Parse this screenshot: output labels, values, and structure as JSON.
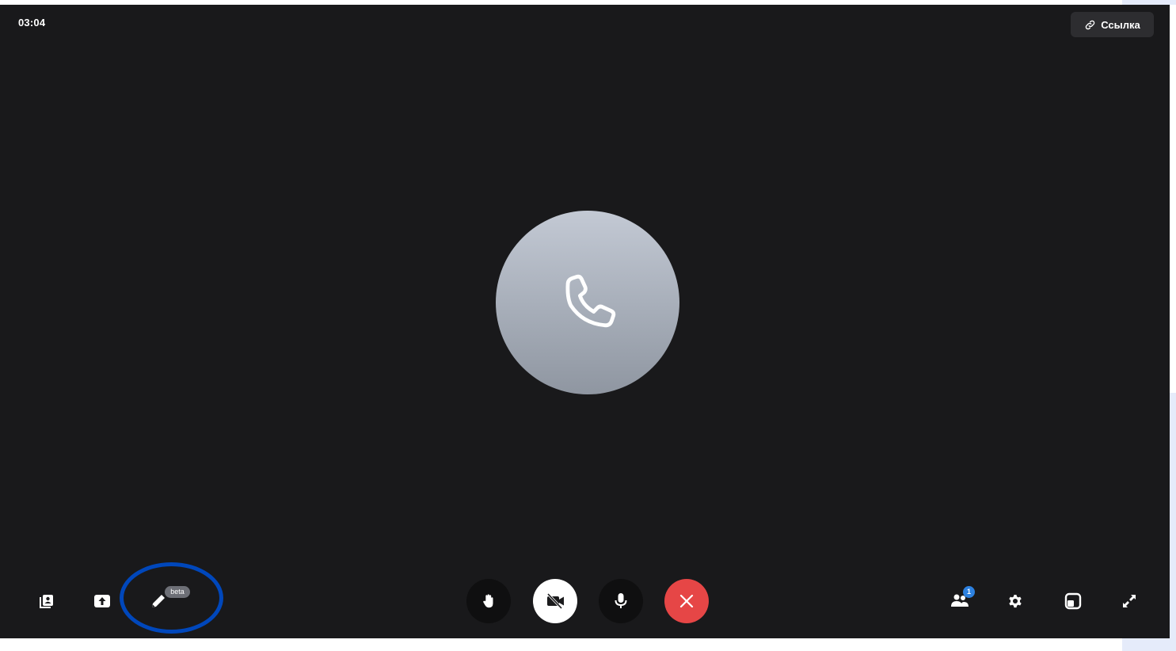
{
  "call": {
    "timer": "03:04",
    "link_label": "Ссылка"
  },
  "avatar": {
    "icon": "phone-icon"
  },
  "toolbar_left": [
    {
      "name": "participants-list-button",
      "icon": "contact-list-icon"
    },
    {
      "name": "share-screen-button",
      "icon": "upload-icon"
    },
    {
      "name": "whiteboard-button",
      "icon": "pencil-icon",
      "badge": "beta"
    }
  ],
  "toolbar_center": [
    {
      "name": "raise-hand-button",
      "icon": "hand-icon"
    },
    {
      "name": "camera-toggle-button",
      "icon": "camera-off-icon"
    },
    {
      "name": "microphone-button",
      "icon": "microphone-icon"
    },
    {
      "name": "end-call-button",
      "icon": "close-icon",
      "color": "#e64646"
    }
  ],
  "toolbar_right": [
    {
      "name": "participants-button",
      "icon": "people-icon",
      "badge": "1"
    },
    {
      "name": "settings-button",
      "icon": "gear-icon"
    },
    {
      "name": "layout-button",
      "icon": "layout-icon"
    },
    {
      "name": "fullscreen-button",
      "icon": "expand-icon"
    }
  ],
  "colors": {
    "background": "#19191b",
    "end_call": "#e64646",
    "badge_blue": "#2d81e0",
    "annotation": "#0047bb"
  }
}
